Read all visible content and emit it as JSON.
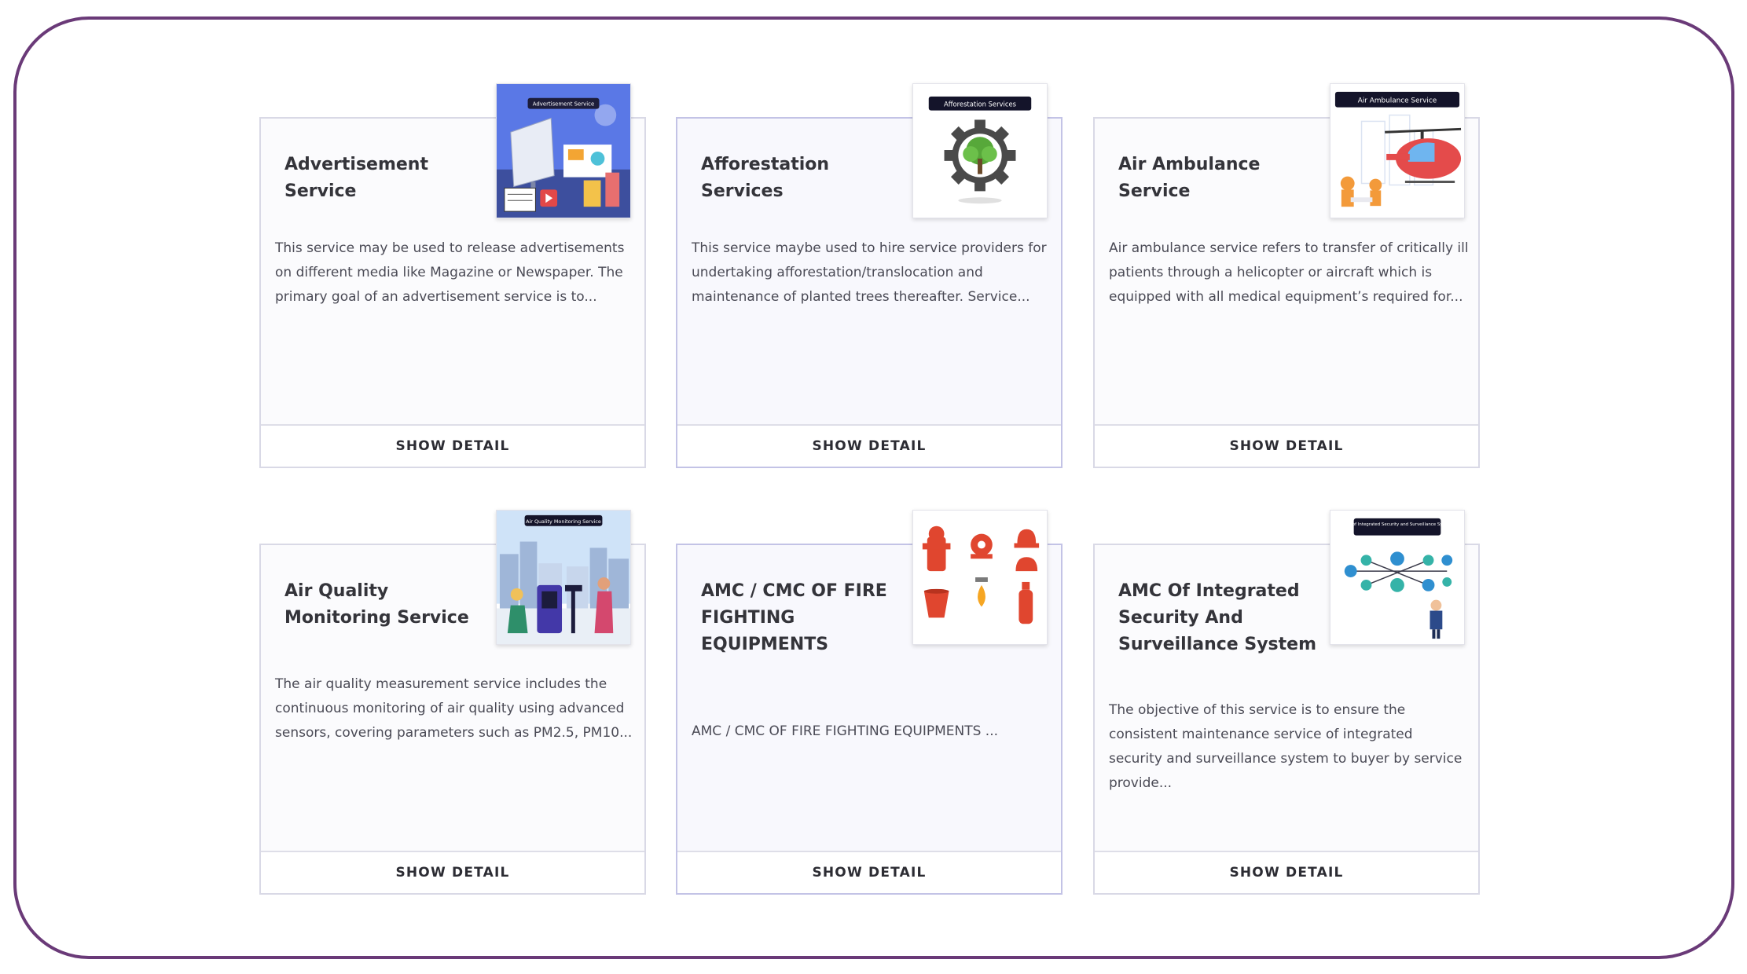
{
  "services": [
    {
      "title": "Advertisement Service",
      "description": "This service may be used to release advertisements on different media like Magazine or Newspaper. The primary goal of an advertisement service is to...",
      "image_caption": "Advertisement Service",
      "button_label": "SHOW DETAIL"
    },
    {
      "title": "Afforestation Services",
      "description": "This service maybe used to hire service providers for undertaking afforestation/translocation and maintenance of planted trees thereafter. Service...",
      "image_caption": "Afforestation Services",
      "button_label": "SHOW DETAIL"
    },
    {
      "title": "Air Ambulance Service",
      "description": "Air ambulance service refers to transfer of critically ill patients through a helicopter or aircraft which is equipped with all medical equipment’s required for...",
      "image_caption": "Air Ambulance Service",
      "button_label": "SHOW DETAIL"
    },
    {
      "title": "Air Quality Monitoring Service",
      "description": "The air quality measurement service includes the continuous monitoring of air quality using advanced sensors, covering parameters such as PM2.5, PM10...",
      "image_caption": "Air Quality Monitoring Service",
      "button_label": "SHOW DETAIL"
    },
    {
      "title": "AMC / CMC OF FIRE FIGHTING EQUIPMENTS",
      "description": "AMC / CMC OF FIRE FIGHTING EQUIPMENTS ...",
      "image_caption": "",
      "button_label": "SHOW DETAIL"
    },
    {
      "title": "AMC Of Integrated Security And Surveillance System",
      "description": "The objective of this service is to ensure the consistent maintenance service of integrated security and surveillance system to buyer by service provide...",
      "image_caption": "AMC of Integrated Security and Surveillance System",
      "button_label": "SHOW DETAIL"
    }
  ],
  "colors": {
    "frame_border": "#6a3a78",
    "card_border": "#d9d9e6",
    "card_highlight_border": "#c3c3e6",
    "title_text": "#34343a",
    "body_text": "#4a4a55"
  },
  "icons": {
    "card_1": "advertisement-billboard-icon",
    "card_2": "gear-tree-icon",
    "card_3": "helicopter-ambulance-icon",
    "card_4": "city-air-sensor-icon",
    "card_5": "fire-equipment-icon",
    "card_6": "security-network-icon"
  }
}
